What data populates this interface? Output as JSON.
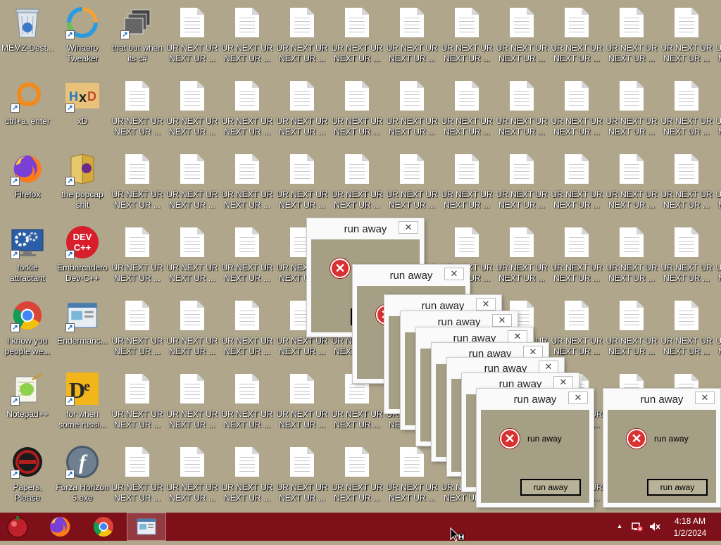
{
  "desktop": {
    "icons": [
      {
        "label": "MEMZ-Dest...",
        "icon": "recycle-bin-icon"
      },
      {
        "label": "Winaero Tweaker",
        "icon": "winaero-tweaker-icon"
      },
      {
        "label": "that but when its c#",
        "icon": "app-shortcut-icon"
      },
      {
        "label": "ctrl+a, enter",
        "icon": "orange-ring-icon"
      },
      {
        "label": "xD",
        "icon": "hxd-icon"
      },
      {
        "label": "Firefox",
        "icon": "firefox-icon"
      },
      {
        "label": "the popcap shit",
        "icon": "popcap-folder-icon"
      },
      {
        "label": "forkie attractant",
        "icon": "monitor-gear-icon"
      },
      {
        "label": "Embarcadero Dev-C++",
        "icon": "devcpp-icon"
      },
      {
        "label": "i know you people we...",
        "icon": "chrome-icon"
      },
      {
        "label": "Endermanc...",
        "icon": "window-app-icon"
      },
      {
        "label": "Notepad++",
        "icon": "notepadpp-icon"
      },
      {
        "label": "for when some russi...",
        "icon": "de-app-icon"
      },
      {
        "label": "Papers, Please",
        "icon": "papers-please-icon"
      },
      {
        "label": "Forza Horizon 5.exe",
        "icon": "flash-icon"
      }
    ],
    "file_label": "UR NEXT UR NEXT UR ..."
  },
  "dialogs": {
    "title": "run away",
    "message": "run away",
    "button": "run away",
    "close_glyph": "✕"
  },
  "taskbar": {
    "time": "4:18 AM",
    "date": "1/2/2024",
    "pinned": [
      "start-orb-icon",
      "firefox-icon",
      "chrome-icon",
      "window-app-icon"
    ]
  },
  "colors": {
    "desktop_bg": "#b0a68c",
    "taskbar_bg": "#7d1018",
    "dialog_client": "#a59f85",
    "error_red": "#d93030"
  }
}
